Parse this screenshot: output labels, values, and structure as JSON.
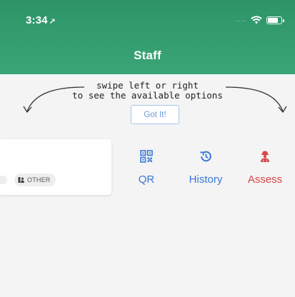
{
  "status_bar": {
    "time": "3:34",
    "location_glyph": "➚",
    "signal_dots": "....",
    "wifi_icon": "wifi-icon",
    "battery_icon": "battery-icon"
  },
  "header": {
    "title": "Staff",
    "background": "#3aa577"
  },
  "hint": {
    "line1": "swipe left or right",
    "line2": "to see the available options",
    "button_label": "Got It!"
  },
  "card": {
    "tag_label": "OTHER",
    "tag_icon": "person-badge-icon"
  },
  "actions": [
    {
      "label": "QR",
      "icon": "qr-code-icon",
      "color": "#3a77d6"
    },
    {
      "label": "History",
      "icon": "history-icon",
      "color": "#3a77d6"
    },
    {
      "label": "Assess",
      "icon": "assess-worker-icon",
      "color": "#d64545"
    }
  ]
}
